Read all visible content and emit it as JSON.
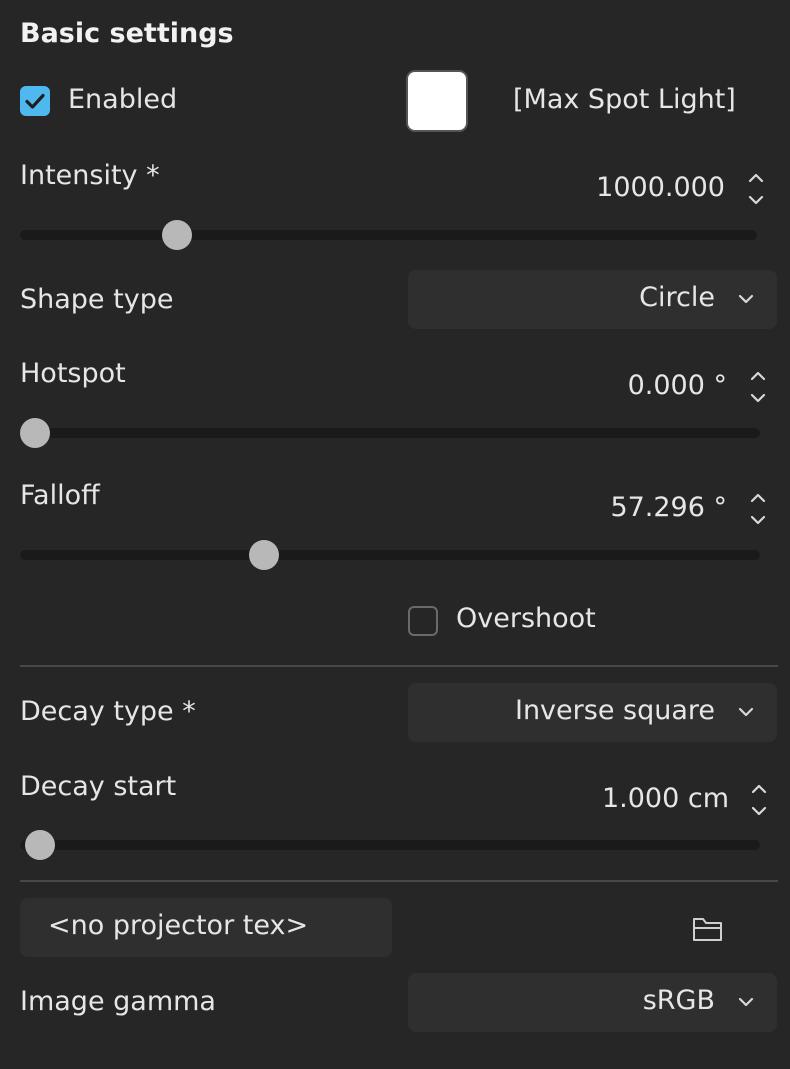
{
  "section": {
    "title": "Basic settings"
  },
  "enabled": {
    "label": "Enabled",
    "checked": true
  },
  "light_color": {
    "hex": "#ffffff"
  },
  "light_name": "[Max Spot Light]",
  "intensity": {
    "label": "Intensity *",
    "value": "1000.000",
    "slider_fraction": 0.21
  },
  "shape_type": {
    "label": "Shape type",
    "selected": "Circle"
  },
  "hotspot": {
    "label": "Hotspot",
    "value": "0.000 °",
    "slider_fraction": 0.0
  },
  "falloff": {
    "label": "Falloff",
    "value": "57.296 °",
    "slider_fraction": 0.33
  },
  "overshoot": {
    "label": "Overshoot",
    "checked": false
  },
  "decay_type": {
    "label": "Decay type *",
    "selected": "Inverse square"
  },
  "decay_start": {
    "label": "Decay start",
    "value": "1.000 cm",
    "slider_fraction": 0.01
  },
  "projector": {
    "text": "<no projector tex>",
    "browse_icon": "folder-open-icon"
  },
  "image_gamma": {
    "label": "Image gamma",
    "selected": "sRGB"
  },
  "colors": {
    "accent": "#4fb8ef",
    "background": "#262626",
    "field": "#2f2f2f",
    "thumb": "#b8b8b8"
  }
}
